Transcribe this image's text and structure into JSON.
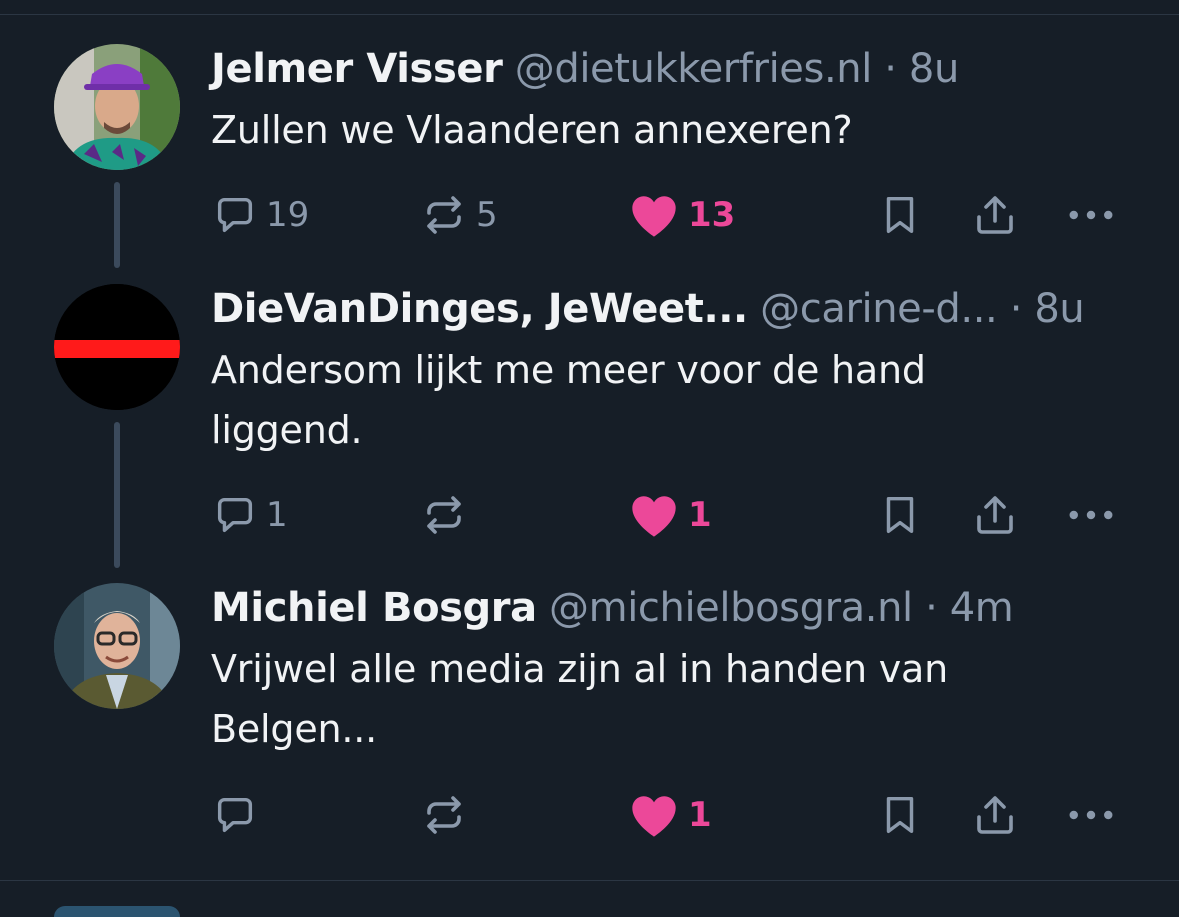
{
  "posts": [
    {
      "name": "Jelmer Visser",
      "handle": "@dietukkerfries.nl",
      "separator": "·",
      "time": "8u",
      "text": "Zullen we Vlaanderen annexeren?",
      "replies": "19",
      "reposts": "5",
      "likes": "13"
    },
    {
      "name": "DieVanDinges, JeWeet...",
      "handle": "@carine-d...",
      "separator": "·",
      "time": "8u",
      "text": "Andersom lijkt me meer voor de hand liggend.",
      "replies": "1",
      "reposts": "",
      "likes": "1"
    },
    {
      "name": "Michiel Bosgra",
      "handle": "@michielbosgra.nl",
      "separator": "·",
      "time": "4m",
      "text": "Vrijwel alle media zijn al in handen van Belgen...",
      "replies": "",
      "reposts": "",
      "likes": "1"
    }
  ],
  "colors": {
    "background": "#161e27",
    "like": "#ec4899",
    "muted": "#8b99ab",
    "thread_line": "#3b4a5c"
  }
}
